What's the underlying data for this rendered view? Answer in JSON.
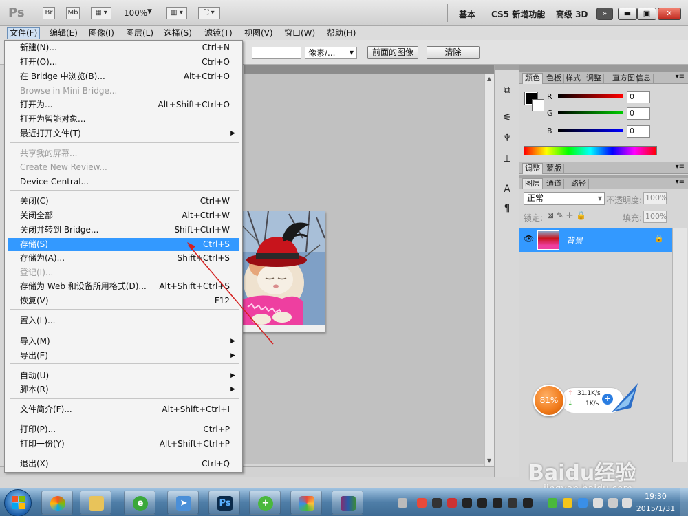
{
  "appbar": {
    "logo": "Ps",
    "btn_br": "Br",
    "btn_mb": "Mb",
    "zoom": "100%",
    "workspaces": [
      "基本",
      "CS5 新增功能",
      "高级 3D"
    ],
    "overflow": "»"
  },
  "menubar": {
    "items": [
      "文件(F)",
      "编辑(E)",
      "图像(I)",
      "图层(L)",
      "选择(S)",
      "滤镜(T)",
      "视图(V)",
      "窗口(W)",
      "帮助(H)"
    ]
  },
  "options": {
    "units": "像素/...",
    "front_image": "前面的图像",
    "clear": "清除"
  },
  "file_menu": [
    {
      "label": "新建(N)...",
      "shortcut": "Ctrl+N"
    },
    {
      "label": "打开(O)...",
      "shortcut": "Ctrl+O"
    },
    {
      "label": "在 Bridge 中浏览(B)...",
      "shortcut": "Alt+Ctrl+O"
    },
    {
      "label": "Browse in Mini Bridge...",
      "shortcut": "",
      "disabled": true
    },
    {
      "label": "打开为...",
      "shortcut": "Alt+Shift+Ctrl+O"
    },
    {
      "label": "打开为智能对象...",
      "shortcut": ""
    },
    {
      "label": "最近打开文件(T)",
      "shortcut": "",
      "submenu": true
    },
    {
      "label": "共享我的屏幕...",
      "shortcut": "",
      "disabled": true
    },
    {
      "label": "Create New Review...",
      "shortcut": "",
      "disabled": true
    },
    {
      "label": "Device Central...",
      "shortcut": ""
    },
    {
      "label": "关闭(C)",
      "shortcut": "Ctrl+W"
    },
    {
      "label": "关闭全部",
      "shortcut": "Alt+Ctrl+W"
    },
    {
      "label": "关闭并转到 Bridge...",
      "shortcut": "Shift+Ctrl+W"
    },
    {
      "label": "存储(S)",
      "shortcut": "Ctrl+S",
      "highlighted": true
    },
    {
      "label": "存储为(A)...",
      "shortcut": "Shift+Ctrl+S"
    },
    {
      "label": "登记(I)...",
      "shortcut": "",
      "disabled": true
    },
    {
      "label": "存储为 Web 和设备所用格式(D)...",
      "shortcut": "Alt+Shift+Ctrl+S"
    },
    {
      "label": "恢复(V)",
      "shortcut": "F12"
    },
    {
      "label": "置入(L)...",
      "shortcut": ""
    },
    {
      "label": "导入(M)",
      "shortcut": "",
      "submenu": true
    },
    {
      "label": "导出(E)",
      "shortcut": "",
      "submenu": true
    },
    {
      "label": "自动(U)",
      "shortcut": "",
      "submenu": true
    },
    {
      "label": "脚本(R)",
      "shortcut": "",
      "submenu": true
    },
    {
      "label": "文件简介(F)...",
      "shortcut": "Alt+Shift+Ctrl+I"
    },
    {
      "label": "打印(P)...",
      "shortcut": "Ctrl+P"
    },
    {
      "label": "打印一份(Y)",
      "shortcut": "Alt+Shift+Ctrl+P"
    },
    {
      "label": "退出(X)",
      "shortcut": "Ctrl+Q"
    }
  ],
  "color_panel": {
    "tabs": [
      "颜色",
      "色板",
      "样式",
      "调整"
    ],
    "tabs2": [
      "直方图",
      "信息"
    ],
    "r_label": "R",
    "g_label": "G",
    "b_label": "B",
    "r": "0",
    "g": "0",
    "b": "0"
  },
  "adjust_panel": {
    "tabs": [
      "调整",
      "蒙版"
    ]
  },
  "layers_panel": {
    "tabs": [
      "图层",
      "通道",
      "路径"
    ],
    "blend_mode": "正常",
    "opacity_label": "不透明度:",
    "opacity": "100%",
    "lock_label": "锁定:",
    "fill_label": "填充:",
    "fill": "100%",
    "layer_name": "背景"
  },
  "net_widget": {
    "percent": "81%",
    "up": "31.1K/s",
    "down": "1K/s"
  },
  "taskbar": {
    "ps_label": "Ps",
    "time": "19:30",
    "date": "2015/1/31"
  },
  "watermark": {
    "brand": "Baidu经验",
    "url": "jingyan.baidu.com"
  },
  "colors": {
    "highlight": "#3399ff",
    "annotation_arrow": "#d42020",
    "hat_red": "#c8141c",
    "widget_orange": "#f07a1a"
  }
}
